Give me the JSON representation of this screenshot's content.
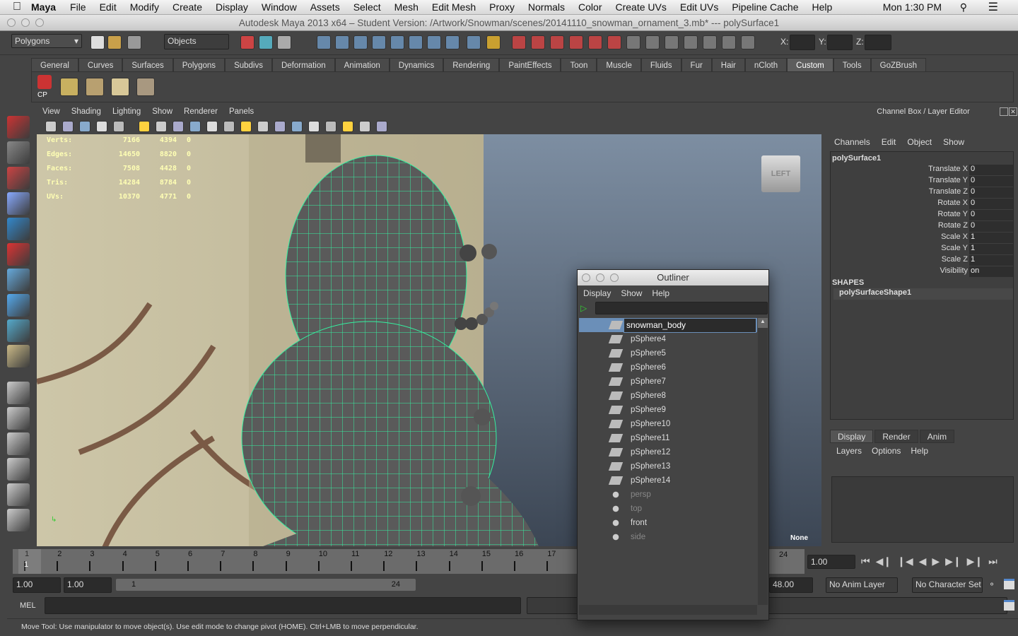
{
  "menubar": {
    "app": "Maya",
    "items": [
      "File",
      "Edit",
      "Modify",
      "Create",
      "Display",
      "Window",
      "Assets",
      "Select",
      "Mesh",
      "Edit Mesh",
      "Proxy",
      "Normals",
      "Color",
      "Create UVs",
      "Edit UVs",
      "Pipeline Cache",
      "Help"
    ],
    "clock": "Mon 1:30 PM"
  },
  "window": {
    "title": "Autodesk Maya 2013 x64 – Student Version: /Artwork/Snowman/scenes/20141110_snowman_ornament_3.mb*  ---   polySurface1"
  },
  "toolbar": {
    "menuset": "Polygons",
    "selection_mode": "Objects",
    "x_label": "X:",
    "y_label": "Y:",
    "z_label": "Z:"
  },
  "shelf": {
    "tabs": [
      "General",
      "Curves",
      "Surfaces",
      "Polygons",
      "Subdivs",
      "Deformation",
      "Animation",
      "Dynamics",
      "Rendering",
      "PaintEffects",
      "Toon",
      "Muscle",
      "Fluids",
      "Fur",
      "Hair",
      "nCloth",
      "Custom",
      "Tools",
      "GoZBrush"
    ],
    "active": "Custom",
    "cp_label": "CP"
  },
  "panel": {
    "menu": [
      "View",
      "Shading",
      "Lighting",
      "Show",
      "Renderer",
      "Panels"
    ]
  },
  "hud": {
    "rows": [
      [
        "Verts:",
        "7166",
        "4394",
        "0"
      ],
      [
        "Edges:",
        "14650",
        "8820",
        "0"
      ],
      [
        "Faces:",
        "7508",
        "4428",
        "0"
      ],
      [
        "Tris:",
        "14284",
        "8784",
        "0"
      ],
      [
        "UVs:",
        "10370",
        "4771",
        "0"
      ]
    ],
    "viewcube": "LEFT",
    "camera": "None"
  },
  "channel_box": {
    "title": "Channel Box / Layer Editor",
    "menu": [
      "Channels",
      "Edit",
      "Object",
      "Show"
    ],
    "object": "polySurface1",
    "channels": [
      [
        "Translate X",
        "0"
      ],
      [
        "Translate Y",
        "0"
      ],
      [
        "Translate Z",
        "0"
      ],
      [
        "Rotate X",
        "0"
      ],
      [
        "Rotate Y",
        "0"
      ],
      [
        "Rotate Z",
        "0"
      ],
      [
        "Scale X",
        "1"
      ],
      [
        "Scale Y",
        "1"
      ],
      [
        "Scale Z",
        "1"
      ],
      [
        "Visibility",
        "on"
      ]
    ],
    "shapes_label": "SHAPES",
    "shape": "polySurfaceShape1"
  },
  "layer_editor": {
    "tabs": [
      "Display",
      "Render",
      "Anim"
    ],
    "active": "Display",
    "menu": [
      "Layers",
      "Options",
      "Help"
    ]
  },
  "timeline": {
    "ticks": [
      "1",
      "2",
      "3",
      "4",
      "5",
      "6",
      "7",
      "8",
      "9",
      "10",
      "11",
      "12",
      "13",
      "14",
      "15",
      "16",
      "17"
    ],
    "current": "1",
    "end_label": "24",
    "current_time": "1.00"
  },
  "range": {
    "start": "1.00",
    "start2": "1.00",
    "slider_start": "1",
    "slider_end": "24",
    "end": "48.00",
    "anim_layer": "No Anim Layer",
    "char_set": "No Character Set"
  },
  "mel": {
    "label": "MEL",
    "value": ""
  },
  "help_line": "Move Tool: Use manipulator to move object(s). Use edit mode to change pivot (HOME).  Ctrl+LMB to move perpendicular.",
  "outliner": {
    "title": "Outliner",
    "menu": [
      "Display",
      "Show",
      "Help"
    ],
    "filter": "",
    "rename_value": "snowman_body",
    "items": [
      {
        "name": "pSphere4",
        "type": "mesh"
      },
      {
        "name": "pSphere5",
        "type": "mesh"
      },
      {
        "name": "pSphere6",
        "type": "mesh"
      },
      {
        "name": "pSphere7",
        "type": "mesh"
      },
      {
        "name": "pSphere8",
        "type": "mesh"
      },
      {
        "name": "pSphere9",
        "type": "mesh"
      },
      {
        "name": "pSphere10",
        "type": "mesh"
      },
      {
        "name": "pSphere11",
        "type": "mesh"
      },
      {
        "name": "pSphere12",
        "type": "mesh"
      },
      {
        "name": "pSphere13",
        "type": "mesh"
      },
      {
        "name": "pSphere14",
        "type": "mesh"
      },
      {
        "name": "persp",
        "type": "camera",
        "hidden": true
      },
      {
        "name": "top",
        "type": "camera",
        "hidden": true
      },
      {
        "name": "front",
        "type": "camera",
        "hidden": false
      },
      {
        "name": "side",
        "type": "camera",
        "hidden": true
      }
    ]
  },
  "colors": {
    "wireframe": "#35f0a0",
    "selection": "#6b8fb8",
    "hud_text": "#ffffb4"
  }
}
